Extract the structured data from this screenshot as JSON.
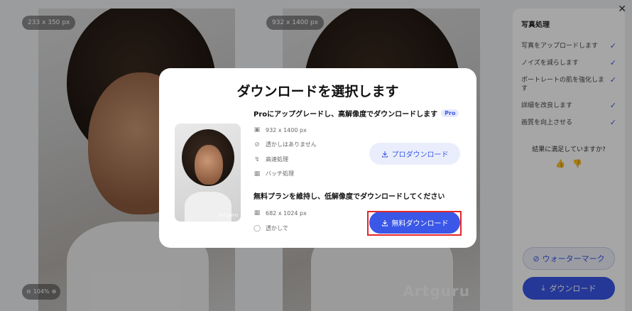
{
  "left_image": {
    "size_label": "233 x 350 px",
    "zoom_label": "104%"
  },
  "right_image": {
    "size_label": "932 x 1400 px",
    "watermark": "Artguru"
  },
  "sidebar": {
    "title": "写真処理",
    "steps": [
      "写真をアップロードします",
      "ノイズを減らします",
      "ポートレートの肌を強化します",
      "詳細を改良します",
      "画質を向上させる"
    ],
    "feedback_question": "結果に満足していますか?",
    "watermark_button": "ウォーターマーク",
    "download_button": "ダウンロード"
  },
  "modal": {
    "title": "ダウンロードを選択します",
    "thumb_watermark": "Artguru",
    "pro_section_title": "Proにアップグレードし、高解像度でダウンロードします",
    "pro_badge": "Pro",
    "pro_features": [
      "932 x 1400 px",
      "透かしはありません",
      "高速処理",
      "バッチ処理"
    ],
    "pro_button": "プロダウンロード",
    "free_section_title": "無料プランを維持し、低解像度でダウンロードしてください",
    "free_features": [
      "682 x 1024 px",
      "透かしで"
    ],
    "free_button": "無料ダウンロード"
  },
  "colors": {
    "accent": "#3a57e8",
    "highlight": "#e3262a"
  }
}
